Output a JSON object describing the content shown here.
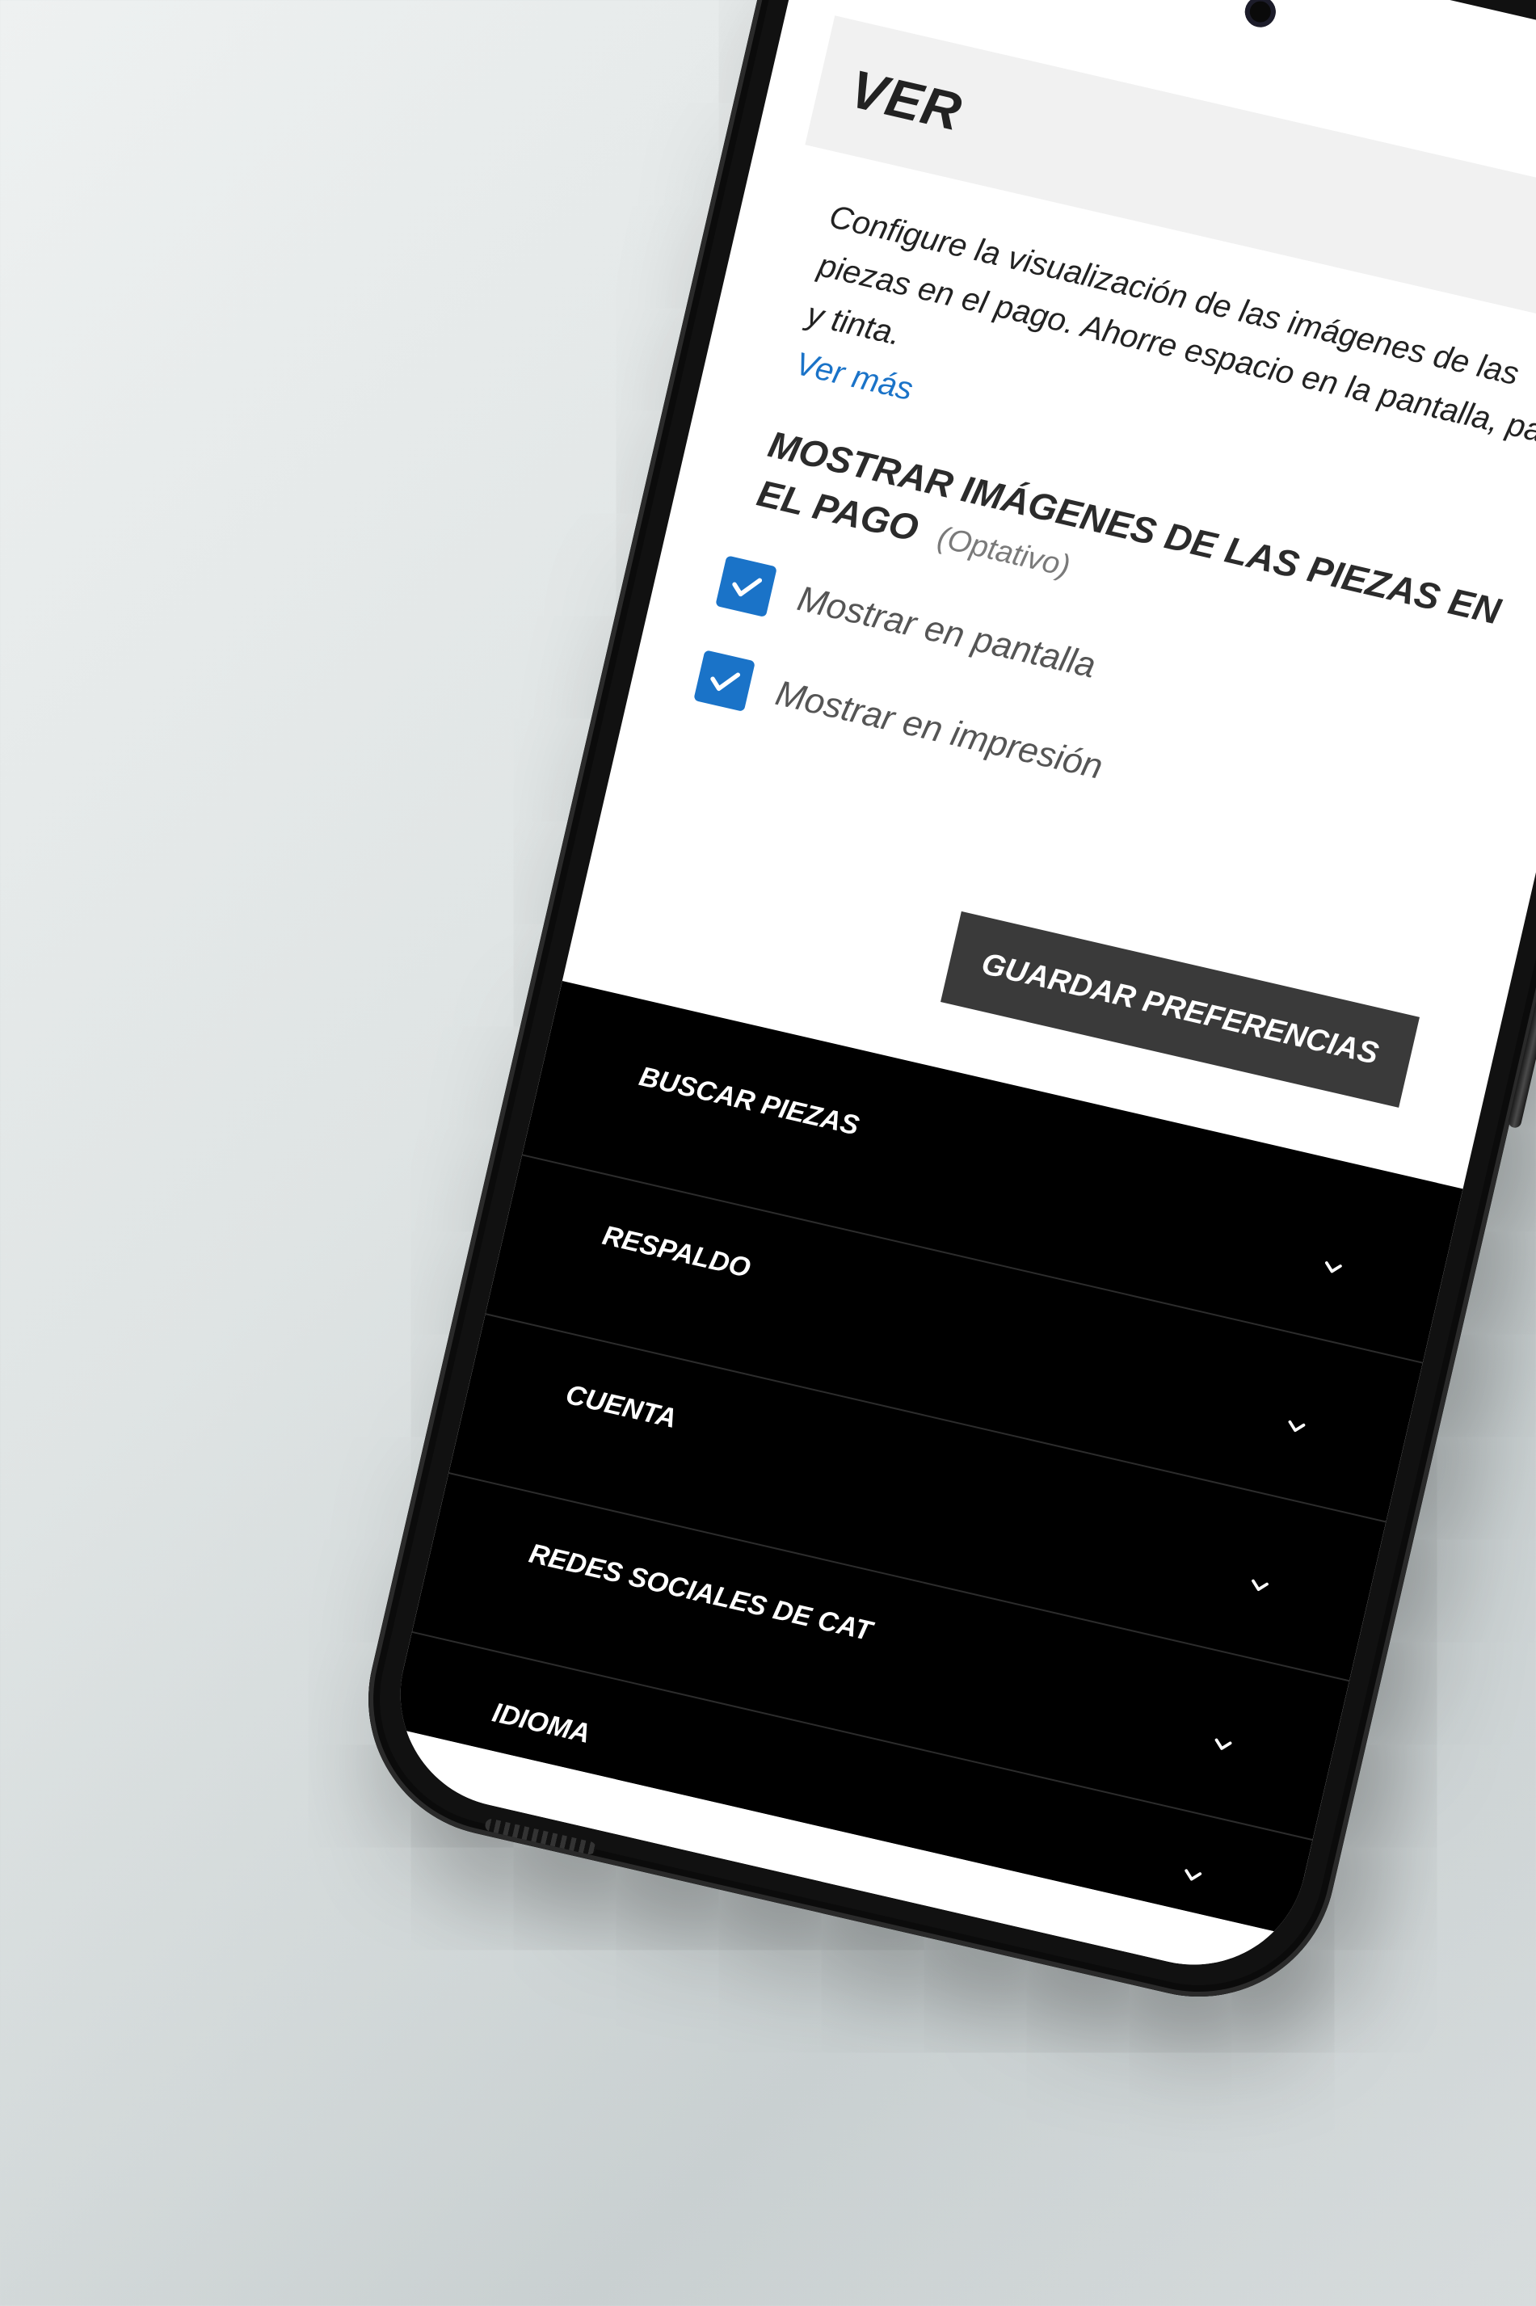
{
  "section": {
    "title": "VER",
    "description": "Configure la visualización de las imágenes de las piezas en el pago. Ahorre espacio en la pantalla, papel y tinta.",
    "see_more": "Ver más"
  },
  "options": {
    "title": "MOSTRAR IMÁGENES DE LAS PIEZAS EN EL PAGO",
    "optional": "(Optativo)",
    "items": [
      {
        "label": "Mostrar en pantalla",
        "checked": true
      },
      {
        "label": "Mostrar en impresión",
        "checked": true
      }
    ]
  },
  "save_label": "GUARDAR PREFERENCIAS",
  "footer": {
    "items": [
      {
        "label": "BUSCAR PIEZAS"
      },
      {
        "label": "RESPALDO"
      },
      {
        "label": "CUENTA"
      },
      {
        "label": "REDES SOCIALES DE CAT"
      },
      {
        "label": "IDIOMA"
      }
    ]
  },
  "colors": {
    "accent": "#1a73c8",
    "button": "#3a3a3a",
    "footer": "#000000",
    "header_bg": "#f1f1f1"
  },
  "icons": {
    "checkbox": "check-icon",
    "footer_chevron": "chevron-down-icon"
  }
}
